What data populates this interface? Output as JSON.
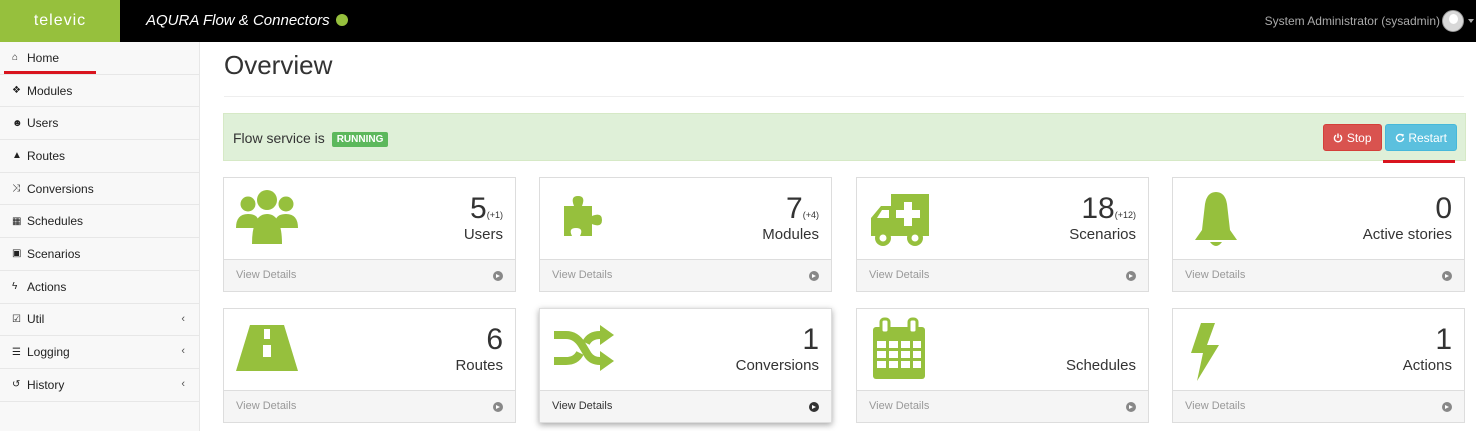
{
  "header": {
    "brand": "televic",
    "title": "AQURA Flow & Connectors",
    "user": "System Administrator (sysadmin)"
  },
  "sidebar": {
    "items": [
      {
        "label": "Home",
        "icon": "home-icon",
        "glyph": "⌂"
      },
      {
        "label": "Modules",
        "icon": "puzzle-icon",
        "glyph": "❖"
      },
      {
        "label": "Users",
        "icon": "users-icon",
        "glyph": "☻"
      },
      {
        "label": "Routes",
        "icon": "road-icon",
        "glyph": "▲"
      },
      {
        "label": "Conversions",
        "icon": "random-icon",
        "glyph": "⤨"
      },
      {
        "label": "Schedules",
        "icon": "calendar-icon",
        "glyph": "▦"
      },
      {
        "label": "Scenarios",
        "icon": "ambulance-icon",
        "glyph": "▣"
      },
      {
        "label": "Actions",
        "icon": "bolt-icon",
        "glyph": "ϟ"
      },
      {
        "label": "Util",
        "icon": "check-square-icon",
        "glyph": "☑"
      },
      {
        "label": "Logging",
        "icon": "list-icon",
        "glyph": "☰"
      },
      {
        "label": "History",
        "icon": "history-icon",
        "glyph": "↺"
      }
    ],
    "caret": "‹"
  },
  "main": {
    "title": "Overview",
    "status_text": "Flow service is",
    "status_badge": "RUNNING",
    "stop_label": "Stop",
    "restart_label": "Restart"
  },
  "panels": [
    {
      "count": "5",
      "delta": "(+1)",
      "label": "Users",
      "footer": "View Details"
    },
    {
      "count": "7",
      "delta": "(+4)",
      "label": "Modules",
      "footer": "View Details"
    },
    {
      "count": "18",
      "delta": "(+12)",
      "label": "Scenarios",
      "footer": "View Details"
    },
    {
      "count": "0",
      "delta": "",
      "label": "Active stories",
      "footer": "View Details"
    },
    {
      "count": "6",
      "delta": "",
      "label": "Routes",
      "footer": "View Details"
    },
    {
      "count": "1",
      "delta": "",
      "label": "Conversions",
      "footer": "View Details"
    },
    {
      "count": "",
      "delta": "",
      "label": "Schedules",
      "footer": "View Details"
    },
    {
      "count": "1",
      "delta": "",
      "label": "Actions",
      "footer": "View Details"
    }
  ],
  "colors": {
    "brand_green": "#96c03d",
    "danger": "#d9534f",
    "info": "#5bc0de",
    "success": "#5cb85c",
    "annotation_red": "#d9141e"
  }
}
